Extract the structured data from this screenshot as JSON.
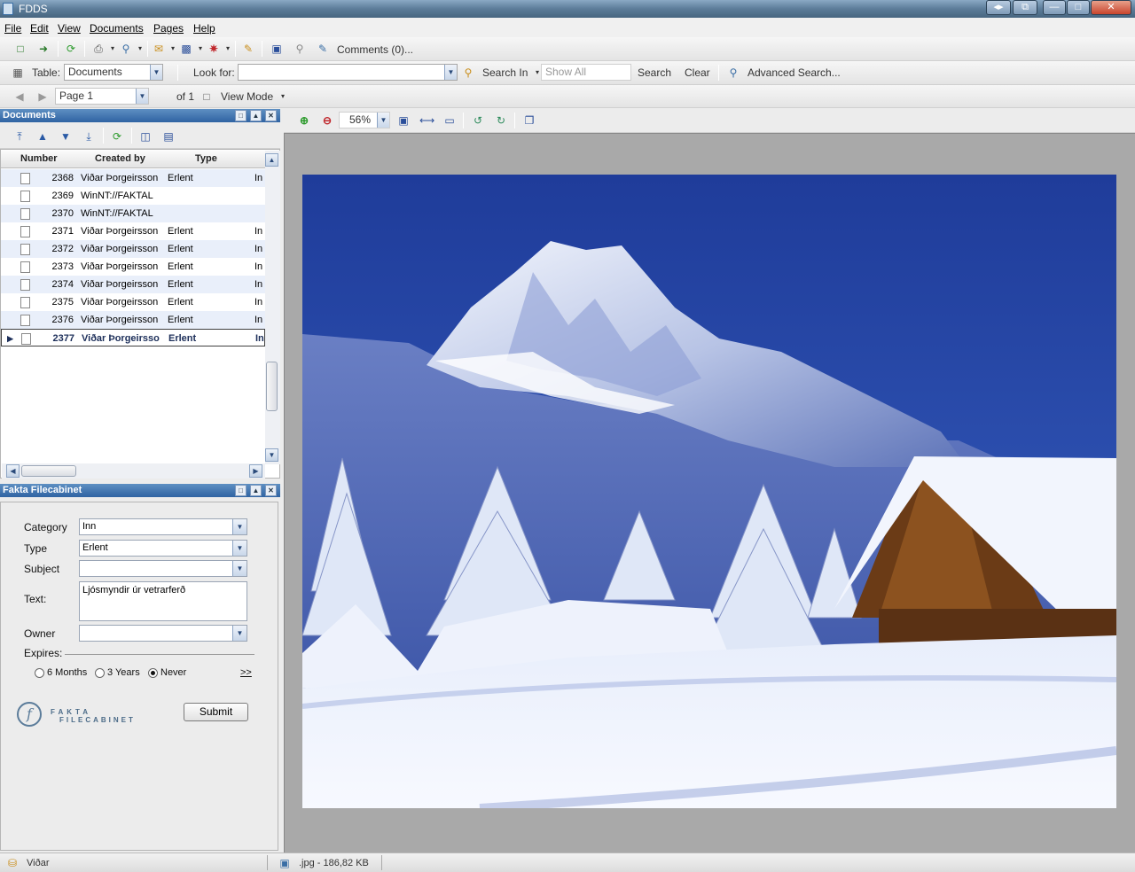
{
  "window": {
    "title": "FDDS"
  },
  "menu": [
    "File",
    "Edit",
    "View",
    "Documents",
    "Pages",
    "Help"
  ],
  "toolbar1": {
    "comments_label": "Comments (0)..."
  },
  "toolbar2": {
    "table_label": "Table:",
    "table_value": "Documents",
    "look_for_label": "Look for:",
    "look_for_value": "",
    "search_in_label": "Search In",
    "show_all_placeholder": "Show All",
    "search_label": "Search",
    "clear_label": "Clear",
    "advanced_label": "Advanced Search..."
  },
  "toolbar3": {
    "page_value": "Page 1",
    "of_label": "of 1",
    "view_mode_label": "View Mode"
  },
  "documents_panel": {
    "title": "Documents",
    "columns": [
      "Number",
      "Created by",
      "Type"
    ],
    "rows": [
      {
        "number": "2368",
        "created_by": "Viðar Þorgeirsson",
        "type": "Erlent",
        "extra": "In"
      },
      {
        "number": "2369",
        "created_by": "WinNT://FAKTAL",
        "type": "",
        "extra": ""
      },
      {
        "number": "2370",
        "created_by": "WinNT://FAKTAL",
        "type": "",
        "extra": ""
      },
      {
        "number": "2371",
        "created_by": "Viðar Þorgeirsson",
        "type": "Erlent",
        "extra": "In"
      },
      {
        "number": "2372",
        "created_by": "Viðar Þorgeirsson",
        "type": "Erlent",
        "extra": "In"
      },
      {
        "number": "2373",
        "created_by": "Viðar Þorgeirsson",
        "type": "Erlent",
        "extra": "In"
      },
      {
        "number": "2374",
        "created_by": "Viðar Þorgeirsson",
        "type": "Erlent",
        "extra": "In"
      },
      {
        "number": "2375",
        "created_by": "Viðar Þorgeirsson",
        "type": "Erlent",
        "extra": "In"
      },
      {
        "number": "2376",
        "created_by": "Viðar Þorgeirsson",
        "type": "Erlent",
        "extra": "In"
      },
      {
        "number": "2377",
        "created_by": "Viðar Þorgeirsso",
        "type": "Erlent",
        "extra": "In"
      }
    ]
  },
  "filecabinet_panel": {
    "title": "Fakta Filecabinet",
    "category_label": "Category",
    "category_value": "Inn",
    "type_label": "Type",
    "type_value": "Erlent",
    "subject_label": "Subject",
    "subject_value": "",
    "text_label": "Text:",
    "text_value": "Ljósmyndir úr vetrarferð",
    "owner_label": "Owner",
    "owner_value": "",
    "expires_label": "Expires:",
    "expires_options": [
      "6 Months",
      "3 Years",
      "Never"
    ],
    "expires_selected": "Never",
    "more_label": ">>",
    "submit_label": "Submit",
    "logo_line1": "FAKTA",
    "logo_line2": "FILECABINET"
  },
  "viewer": {
    "zoom_value": "56%"
  },
  "status": {
    "user": "Viðar",
    "file_info": ".jpg - 186,82 KB"
  }
}
